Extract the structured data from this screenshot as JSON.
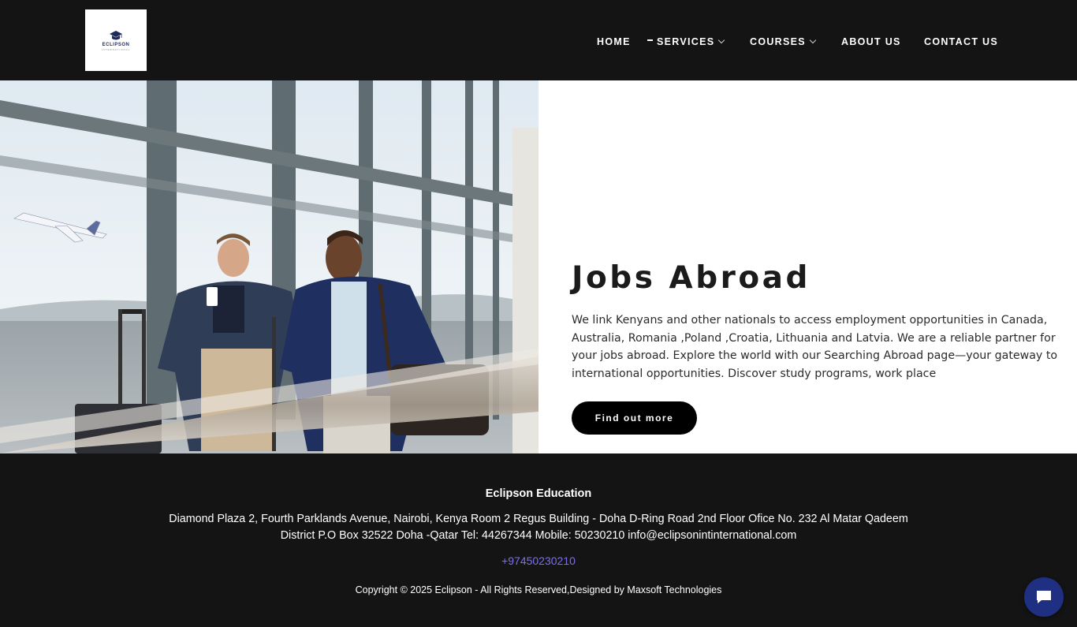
{
  "brand": {
    "logo_text": "ECLIPSON",
    "logo_subtext": "INTERNATIONAL"
  },
  "nav": {
    "items": [
      {
        "label": "HOME",
        "has_dropdown": false,
        "active": false
      },
      {
        "label": "SERVICES",
        "has_dropdown": true,
        "active": true
      },
      {
        "label": "COURSES",
        "has_dropdown": true,
        "active": false
      },
      {
        "label": "ABOUT US",
        "has_dropdown": false,
        "active": false
      },
      {
        "label": "CONTACT US",
        "has_dropdown": false,
        "active": false
      }
    ]
  },
  "hero": {
    "title": "Jobs Abroad",
    "description": " We link Kenyans and other nationals to access employment opportunities in Canada, Australia, Romania ,Poland ,Croatia, Lithuania and Latvia. We are a reliable partner for your jobs abroad.  Explore the world with our Searching Abroad page—your gateway to international opportunities. Discover study programs, work place",
    "button_label": "Find out more"
  },
  "footer": {
    "company": "Eclipson Education",
    "address": "Diamond Plaza 2, Fourth Parklands Avenue, Nairobi, Kenya Room 2 Regus Building - Doha D-Ring Road 2nd Floor Ofice No. 232 Al Matar Qadeem District P.O Box 32522 Doha -Qatar Tel: 44267344 Mobile: 50230210 info@eclipsonintinternational.com",
    "phone": "+97450230210",
    "copyright": "Copyright © 2025 Eclipson - All Rights Reserved,Designed by Maxsoft Technologies"
  },
  "colors": {
    "header_bg": "#141414",
    "footer_bg": "#141414",
    "button_bg": "#000000",
    "link": "#7b6ff0",
    "chat_bg": "#1f2f82"
  },
  "icons": {
    "logo": "graduation-cap-icon",
    "chat": "chat-bubble-icon",
    "dropdown": "chevron-down-icon"
  }
}
